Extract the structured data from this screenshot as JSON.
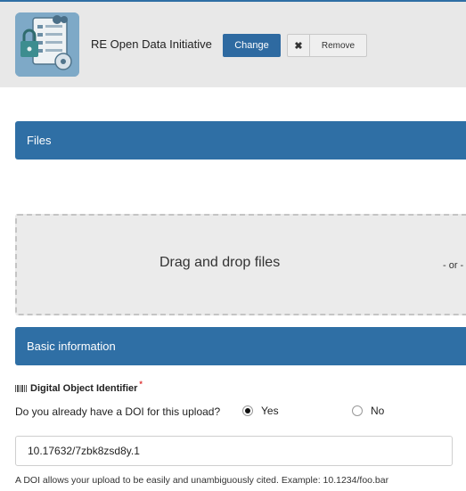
{
  "community": {
    "name": "RE Open Data Initiative",
    "change_label": "Change",
    "remove_label": "Remove"
  },
  "files_section": {
    "title": "Files",
    "drop_text": "Drag and drop files",
    "or_text": "- or -"
  },
  "basic_section": {
    "title": "Basic information"
  },
  "doi": {
    "label": "Digital Object Identifier",
    "required_mark": "*",
    "question": "Do you already have a DOI for this upload?",
    "yes_label": "Yes",
    "no_label": "No",
    "selected": "Yes",
    "value": "10.17632/7zbk8zsd8y.1",
    "help": "A DOI allows your upload to be easily and unambiguously cited. Example: 10.1234/foo.bar"
  },
  "colors": {
    "accent": "#2f6fa5",
    "button": "#2e6aa1",
    "required": "#dd3333"
  }
}
